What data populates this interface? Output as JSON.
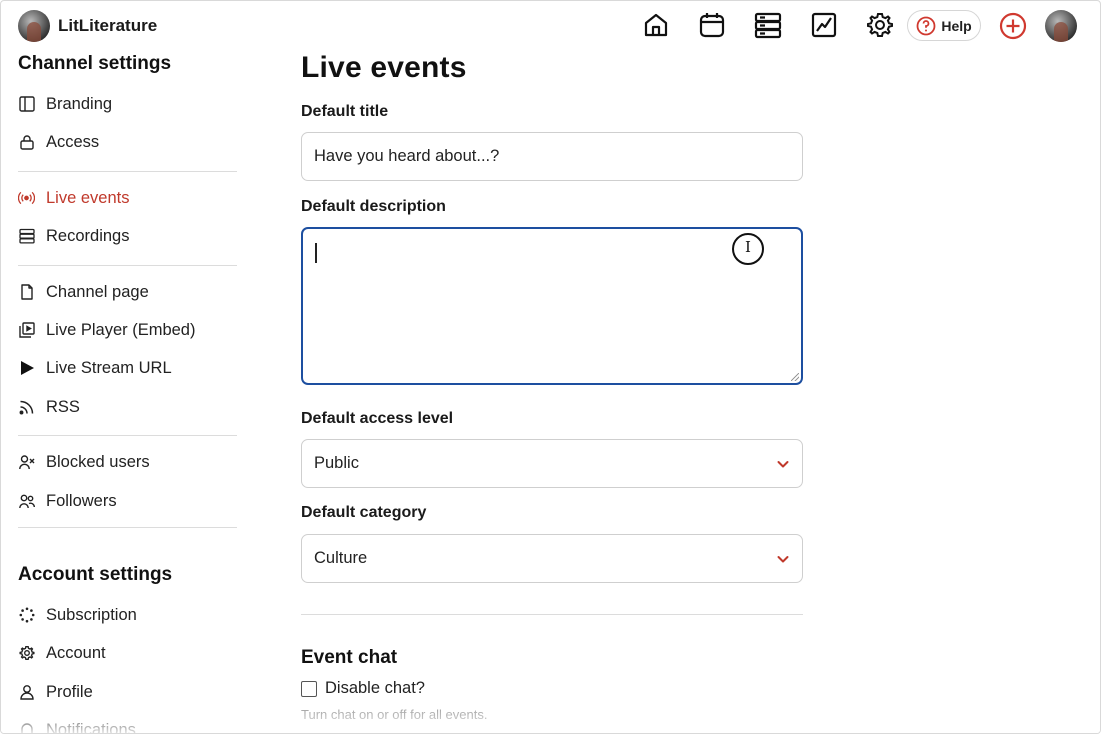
{
  "header": {
    "brand_name": "LitLiterature",
    "icons": [
      "home-icon",
      "calendar-icon",
      "server-icon",
      "analytics-icon",
      "gear-icon"
    ],
    "help_label": "Help",
    "add_icon": "plus-circle-icon",
    "accent_color": "#d0392f"
  },
  "sidebar": {
    "channel_title": "Channel settings",
    "channel_items": [
      {
        "label": "Branding",
        "icon": "layout-icon"
      },
      {
        "label": "Access",
        "icon": "lock-icon"
      },
      {
        "label": "Live events",
        "icon": "broadcast-icon",
        "active": true
      },
      {
        "label": "Recordings",
        "icon": "server-icon"
      },
      {
        "label": "Channel page",
        "icon": "file-icon"
      },
      {
        "label": "Live Player (Embed)",
        "icon": "embed-icon"
      },
      {
        "label": "Live Stream URL",
        "icon": "play-icon"
      },
      {
        "label": "RSS",
        "icon": "rss-icon"
      },
      {
        "label": "Blocked users",
        "icon": "user-x-icon"
      },
      {
        "label": "Followers",
        "icon": "users-icon"
      }
    ],
    "account_title": "Account settings",
    "account_items": [
      {
        "label": "Subscription",
        "icon": "dots-circle-icon"
      },
      {
        "label": "Account",
        "icon": "gear-icon"
      },
      {
        "label": "Profile",
        "icon": "user-icon"
      },
      {
        "label": "Notifications",
        "icon": "bell-icon"
      }
    ],
    "active_color": "#c0392b"
  },
  "main": {
    "page_title": "Live events",
    "default_title_label": "Default title",
    "default_title_value": "Have you heard about...?",
    "default_description_label": "Default description",
    "default_description_value": "",
    "default_access_label": "Default access level",
    "default_access_value": "Public",
    "default_category_label": "Default category",
    "default_category_value": "Culture",
    "event_chat_title": "Event chat",
    "disable_chat_label": "Disable chat?",
    "disable_chat_checked": false,
    "disable_chat_hint": "Turn chat on or off for all events."
  }
}
